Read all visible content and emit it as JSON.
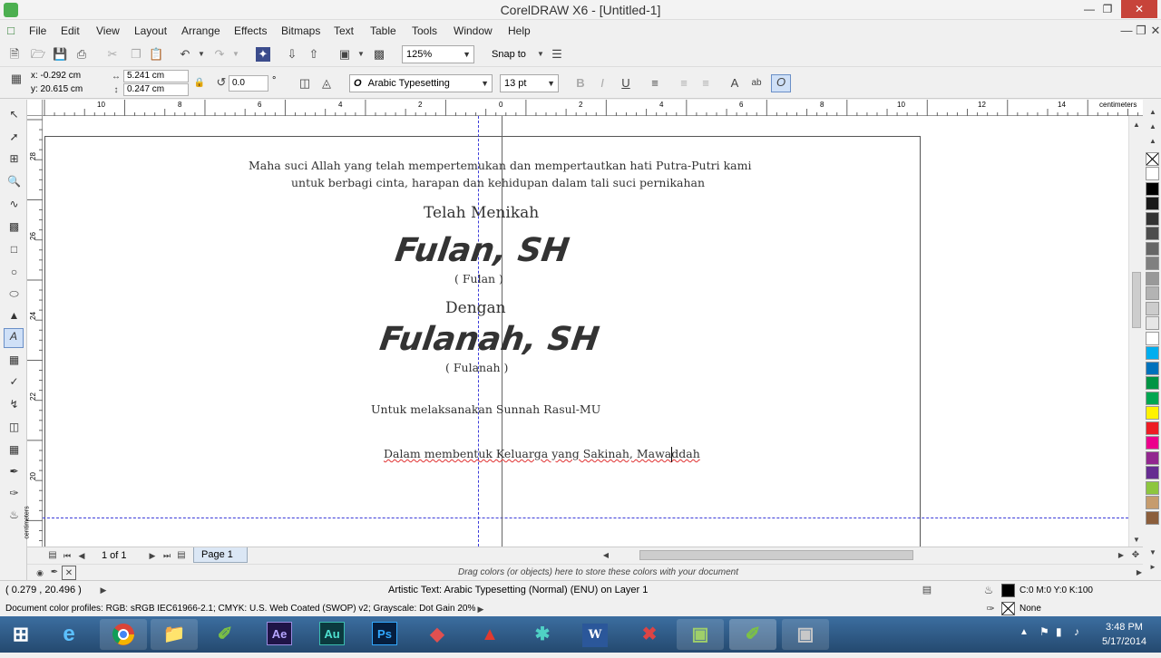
{
  "window": {
    "title": "CorelDRAW X6 - [Untitled-1]"
  },
  "menu": [
    "File",
    "Edit",
    "View",
    "Layout",
    "Arrange",
    "Effects",
    "Bitmaps",
    "Text",
    "Table",
    "Tools",
    "Window",
    "Help"
  ],
  "toolbar": {
    "zoom": "125%",
    "snap_to": "Snap to"
  },
  "property_bar": {
    "x": "x: -0.292 cm",
    "y": "y: 20.615 cm",
    "width": "5.241 cm",
    "height": "0.247 cm",
    "rotation": "0.0",
    "degree": "°",
    "font": "Arabic Typesetting",
    "font_size": "13 pt"
  },
  "ruler": {
    "top_ticks": [
      "10",
      "8",
      "6",
      "4",
      "2",
      "0",
      "2",
      "4",
      "6",
      "8",
      "10",
      "12",
      "14"
    ],
    "unit": "centimeters",
    "left_ticks": [
      "28",
      "26",
      "24",
      "22",
      "20"
    ],
    "left_unit": "centimeters"
  },
  "document": {
    "line1": "Maha suci Allah yang telah mempertemukan dan mempertautkan hati Putra-Putri kami",
    "line2": "untuk berbagi cinta, harapan dan kehidupan dalam tali suci pernikahan",
    "heading": "Telah Menikah",
    "groom": "Fulan, SH",
    "groom_sub": "( Fulan )",
    "connector": "Dengan",
    "bride": "Fulanah, SH",
    "bride_sub": "( Fulanah )",
    "line3": "Untuk melaksanakan Sunnah Rasul-MU",
    "line4": "Dalam membentuk Keluarga yang Sakinah, Mawaddah"
  },
  "page_nav": {
    "count": "1 of 1",
    "page_tab": "Page 1"
  },
  "color_dock": {
    "hint": "Drag colors (or objects) here to store these colors with your document"
  },
  "status": {
    "cursor": "( 0.279 , 20.496 )",
    "object_info": "Artistic Text: Arabic Typesetting (Normal) (ENU) on Layer 1",
    "fill": "C:0 M:0 Y:0 K:100",
    "outline": "None",
    "profiles": "Document color profiles: RGB: sRGB IEC61966-2.1; CMYK: U.S. Web Coated (SWOP) v2; Grayscale: Dot Gain 20%"
  },
  "taskbar": {
    "apps": [
      "Ae",
      "Au",
      "Ps",
      "W"
    ],
    "time": "3:48 PM",
    "date": "5/17/2014"
  },
  "palette_colors": [
    "#ffffff",
    "#000000",
    "#1a1a1a",
    "#333333",
    "#4d4d4d",
    "#666666",
    "#808080",
    "#999999",
    "#b3b3b3",
    "#cccccc",
    "#e6e6e6",
    "#ffffff",
    "#00aeef",
    "#0072bc",
    "#009444",
    "#00a651",
    "#fff200",
    "#ed1c24",
    "#ec008c",
    "#92278f",
    "#662d91",
    "#8dc63f",
    "#c69c6d",
    "#8b5e3c"
  ]
}
